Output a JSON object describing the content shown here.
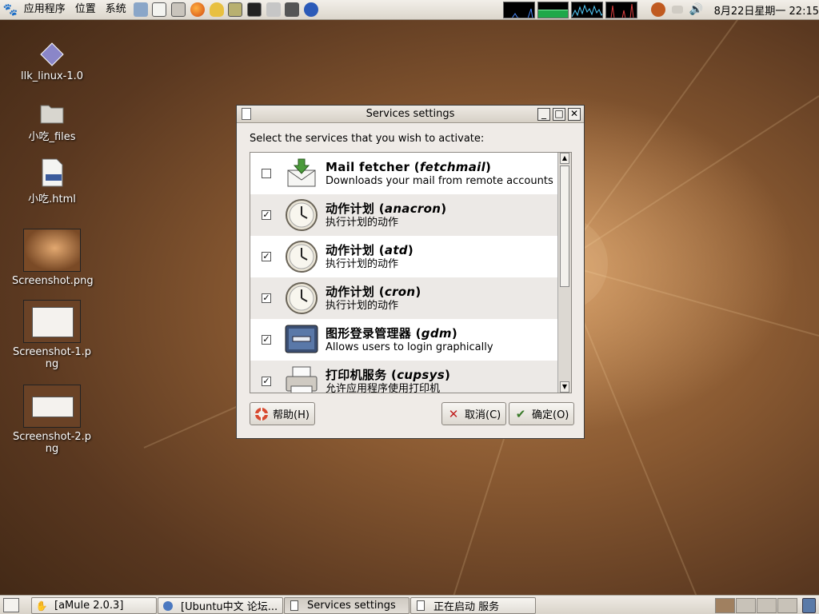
{
  "top_panel": {
    "menus": [
      "应用程序",
      "位置",
      "系统"
    ],
    "clock": "8月22日星期一 22:15"
  },
  "desktop": {
    "icons": [
      {
        "label": "llk_linux-1.0",
        "icon": "diamond-icon"
      },
      {
        "label": "小吃_files",
        "icon": "folder-icon"
      },
      {
        "label": "小吃.html",
        "icon": "html-file-icon"
      },
      {
        "label": "Screenshot.png",
        "icon": "image-thumbnail"
      },
      {
        "label": "Screenshot-1.png",
        "icon": "image-thumbnail"
      },
      {
        "label": "Screenshot-2.png",
        "icon": "image-thumbnail"
      }
    ]
  },
  "dialog": {
    "title": "Services settings",
    "prompt": "Select the services that you wish to activate:",
    "services": [
      {
        "name": "Mail fetcher",
        "id": "fetchmail",
        "desc": "Downloads your mail from remote accounts",
        "checked": false,
        "icon": "mail-icon"
      },
      {
        "name": "动作计划",
        "id": "anacron",
        "desc": "执行计划的动作",
        "checked": true,
        "icon": "clock-icon"
      },
      {
        "name": "动作计划",
        "id": "atd",
        "desc": "执行计划的动作",
        "checked": true,
        "icon": "clock-icon"
      },
      {
        "name": "动作计划",
        "id": "cron",
        "desc": "执行计划的动作",
        "checked": true,
        "icon": "clock-icon"
      },
      {
        "name": "图形登录管理器",
        "id": "gdm",
        "desc": "Allows users to login graphically",
        "checked": true,
        "icon": "login-screen-icon"
      },
      {
        "name": "打印机服务",
        "id": "cupsys",
        "desc": "允许应用程序使用打印机",
        "checked": true,
        "icon": "printer-icon"
      }
    ],
    "buttons": {
      "help": "帮助(H)",
      "cancel": "取消(C)",
      "ok": "确定(O)"
    }
  },
  "taskbar": {
    "tasks": [
      "[aMule 2.0.3]",
      "[Ubuntu中文 论坛...",
      "Services settings",
      "正在启动 服务"
    ]
  },
  "colors": {
    "desktop": "#8a5a32",
    "panel": "#e6e1d9",
    "dialog_bg": "#efebe7"
  }
}
